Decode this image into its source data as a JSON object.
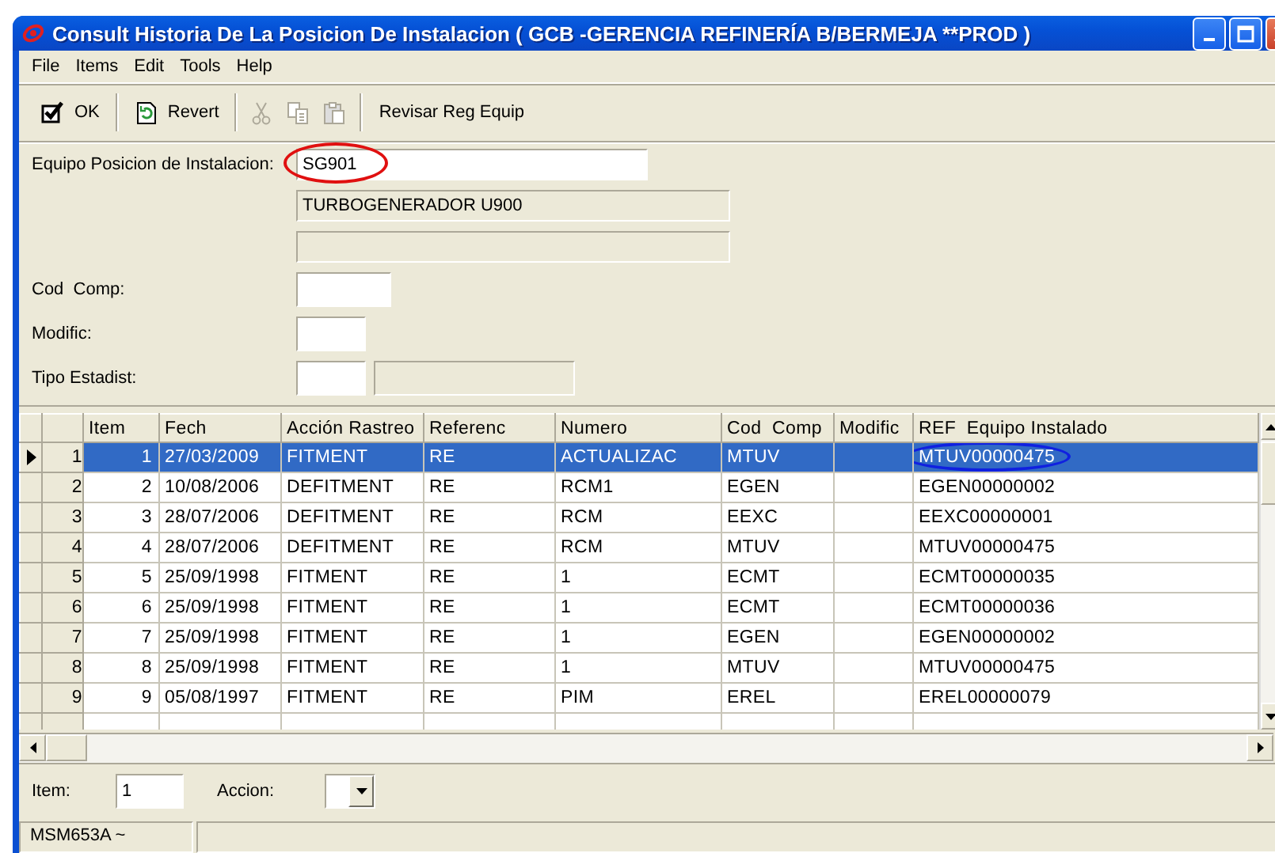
{
  "window": {
    "title": "Consult Historia De La Posicion De Instalacion ( GCB -GERENCIA REFINERÍA B/BERMEJA **PROD )"
  },
  "menu": [
    "File",
    "Items",
    "Edit",
    "Tools",
    "Help"
  ],
  "toolbar": [
    {
      "kind": "confirm",
      "label": "OK"
    },
    {
      "kind": "separator"
    },
    {
      "kind": "revert",
      "label": "Revert"
    },
    {
      "kind": "separator"
    },
    {
      "kind": "cut",
      "disabled": true
    },
    {
      "kind": "copy",
      "disabled": true
    },
    {
      "kind": "paste",
      "disabled": true
    },
    {
      "kind": "separator"
    },
    {
      "kind": "text",
      "label": "Revisar Reg Equip"
    }
  ],
  "form": {
    "equipo": {
      "label": "Equipo Posicion de Instalacion:",
      "value": "SG901",
      "circled": true
    },
    "description": "TURBOGENERADOR U900",
    "cod_comp": {
      "label": "Cod  Comp:"
    },
    "modific": {
      "label": "Modific:"
    },
    "tipo_estadist": {
      "label": "Tipo Estadist:"
    }
  },
  "grid": {
    "columns": [
      "Item",
      "Fech",
      "Acción Rastreo",
      "Referenc",
      "Numero",
      "Cod  Comp",
      "Modific",
      "REF  Equipo Instalado"
    ],
    "rows": [
      {
        "row_number": "1",
        "item": "1",
        "fech": "27/03/2009",
        "accion": "FITMENT",
        "referenc": "RE",
        "numero": "ACTUALIZAC",
        "cod_comp": "MTUV",
        "ref": "MTUV00000475",
        "selected": true,
        "circled": true
      },
      {
        "row_number": "2",
        "item": "2",
        "fech": "10/08/2006",
        "accion": "DEFITMENT",
        "referenc": "RE",
        "numero": "RCM1",
        "cod_comp": "EGEN",
        "ref": "EGEN00000002",
        "selected": false,
        "circled": false
      },
      {
        "row_number": "3",
        "item": "3",
        "fech": "28/07/2006",
        "accion": "DEFITMENT",
        "referenc": "RE",
        "numero": "RCM",
        "cod_comp": "EEXC",
        "ref": "EEXC00000001",
        "selected": false,
        "circled": false
      },
      {
        "row_number": "4",
        "item": "4",
        "fech": "28/07/2006",
        "accion": "DEFITMENT",
        "referenc": "RE",
        "numero": "RCM",
        "cod_comp": "MTUV",
        "ref": "MTUV00000475",
        "selected": false,
        "circled": false
      },
      {
        "row_number": "5",
        "item": "5",
        "fech": "25/09/1998",
        "accion": "FITMENT",
        "referenc": "RE",
        "numero": "1",
        "cod_comp": "ECMT",
        "ref": "ECMT00000035",
        "selected": false,
        "circled": false
      },
      {
        "row_number": "6",
        "item": "6",
        "fech": "25/09/1998",
        "accion": "FITMENT",
        "referenc": "RE",
        "numero": "1",
        "cod_comp": "ECMT",
        "ref": "ECMT00000036",
        "selected": false,
        "circled": false
      },
      {
        "row_number": "7",
        "item": "7",
        "fech": "25/09/1998",
        "accion": "FITMENT",
        "referenc": "RE",
        "numero": "1",
        "cod_comp": "EGEN",
        "ref": "EGEN00000002",
        "selected": false,
        "circled": false
      },
      {
        "row_number": "8",
        "item": "8",
        "fech": "25/09/1998",
        "accion": "FITMENT",
        "referenc": "RE",
        "numero": "1",
        "cod_comp": "MTUV",
        "ref": "MTUV00000475",
        "selected": false,
        "circled": false
      },
      {
        "row_number": "9",
        "item": "9",
        "fech": "05/08/1997",
        "accion": "FITMENT",
        "referenc": "RE",
        "numero": "PIM",
        "cod_comp": "EREL",
        "ref": "EREL00000079",
        "selected": false,
        "circled": false
      }
    ]
  },
  "footer": {
    "item": {
      "label": "Item:",
      "value": "1"
    },
    "accion": {
      "label": "Accion:"
    }
  },
  "status_bar": [
    "MSM653A ~"
  ]
}
